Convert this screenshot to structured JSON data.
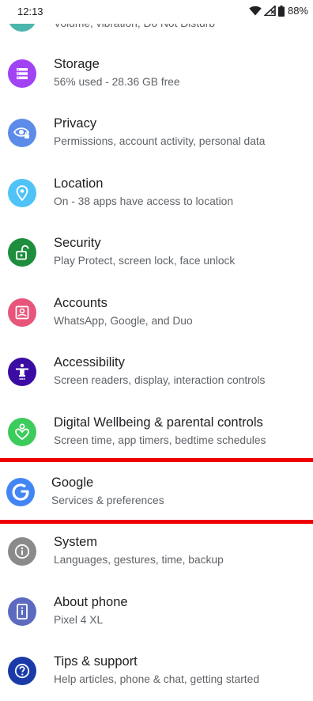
{
  "status_bar": {
    "time": "12:13",
    "battery": "88%"
  },
  "partial_item": {
    "subtitle": "Volume, vibration, Do Not Disturb",
    "color": "#4db6ac"
  },
  "items": [
    {
      "title": "Storage",
      "subtitle": "56% used - 28.36 GB free",
      "icon": "storage-icon",
      "color": "#a142f4"
    },
    {
      "title": "Privacy",
      "subtitle": "Permissions, account activity, personal data",
      "icon": "privacy-eye-icon",
      "color": "#5c8ce8"
    },
    {
      "title": "Location",
      "subtitle": "On - 38 apps have access to location",
      "icon": "location-pin-icon",
      "color": "#4fc3f7"
    },
    {
      "title": "Security",
      "subtitle": "Play Protect, screen lock, face unlock",
      "icon": "padlock-icon",
      "color": "#1e8e3e"
    },
    {
      "title": "Accounts",
      "subtitle": "WhatsApp, Google, and Duo",
      "icon": "account-box-icon",
      "color": "#e8557a"
    },
    {
      "title": "Accessibility",
      "subtitle": "Screen readers, display, interaction controls",
      "icon": "accessibility-person-icon",
      "color": "#3a0ca3"
    },
    {
      "title": "Digital Wellbeing & parental controls",
      "subtitle": "Screen time, app timers, bedtime schedules",
      "icon": "wellbeing-heart-icon",
      "color": "#3ccc5c"
    },
    {
      "title": "Google",
      "subtitle": "Services & preferences",
      "icon": "google-g-icon",
      "color": "#4285f4"
    },
    {
      "title": "System",
      "subtitle": "Languages, gestures, time, backup",
      "icon": "info-icon",
      "color": "#8a8a8a"
    },
    {
      "title": "About phone",
      "subtitle": "Pixel 4 XL",
      "icon": "phone-icon",
      "color": "#5c6bc0"
    },
    {
      "title": "Tips & support",
      "subtitle": "Help articles, phone & chat, getting started",
      "icon": "help-icon",
      "color": "#1a3aa8"
    }
  ],
  "highlight_color": "#ee0000"
}
